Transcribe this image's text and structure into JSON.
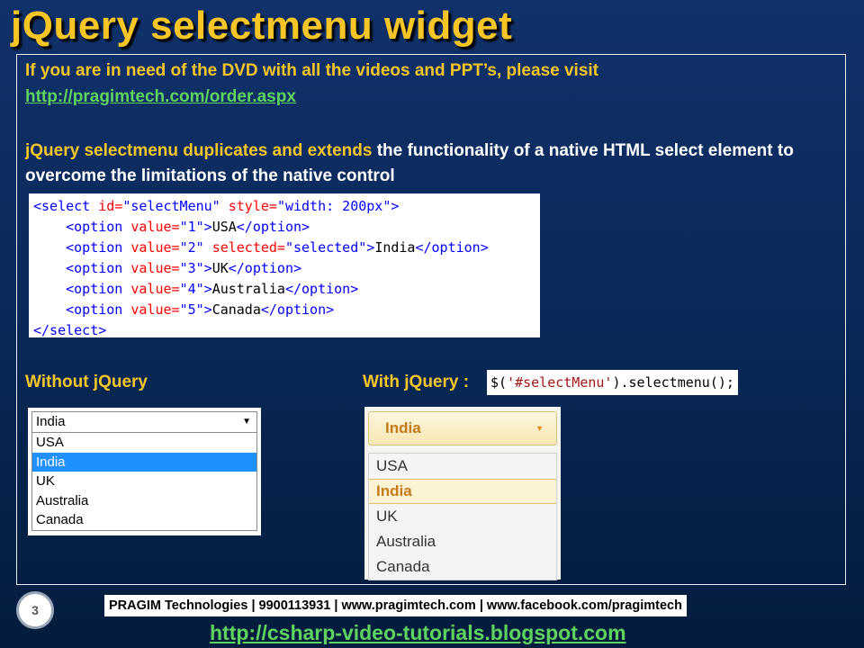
{
  "slide": {
    "title": "jQuery selectmenu widget",
    "dvd_text": "If you are in need of the DVD with all the videos and PPT’s, please visit",
    "dvd_link": "http://pragimtech.com/order.aspx",
    "desc_highlight": "jQuery selectmenu duplicates and extends",
    "desc_rest": " the functionality of a native HTML select element to overcome the limitations of the native control",
    "code": {
      "line0_tag": "<select",
      "line0_attr1": "id=",
      "line0_val1": "\"selectMenu\"",
      "line0_attr2": "style=",
      "line0_val2": "\"width: 200px\"",
      "line0_close": ">",
      "options": [
        {
          "value": "\"1\"",
          "text": "USA",
          "selected": false
        },
        {
          "value": "\"2\"",
          "text": "India",
          "selected": true
        },
        {
          "value": "\"3\"",
          "text": "UK",
          "selected": false
        },
        {
          "value": "\"4\"",
          "text": "Australia",
          "selected": false
        },
        {
          "value": "\"5\"",
          "text": "Canada",
          "selected": false
        }
      ],
      "option_open": "<option",
      "value_attr": "value=",
      "selected_attr": "selected=",
      "selected_val": "\"selected\"",
      "option_close": "</option>",
      "close_tag": "</select>"
    },
    "without_label": "Without jQuery",
    "with_label": "With jQuery :",
    "jq_call_prefix": "$(",
    "jq_call_string": "'#selectMenu'",
    "jq_call_suffix": ").selectmenu();",
    "native_select": {
      "current": "India",
      "arrow": "▼",
      "items": [
        "USA",
        "India",
        "UK",
        "Australia",
        "Canada"
      ],
      "selected_index": 1
    },
    "jq_select": {
      "current": "India",
      "caret": "▼",
      "items": [
        "USA",
        "India",
        "UK",
        "Australia",
        "Canada"
      ],
      "selected_index": 1
    },
    "page_number": "3",
    "footer_text": "PRAGIM Technologies | 9900113931 | www.pragimtech.com | www.facebook.com/pragimtech",
    "footer_link": "http://csharp-video-tutorials.blogspot.com"
  },
  "colors": {
    "accent_yellow": "#f7c626",
    "link_green": "#5fd35f",
    "highlight_blue": "#1e90ff"
  }
}
